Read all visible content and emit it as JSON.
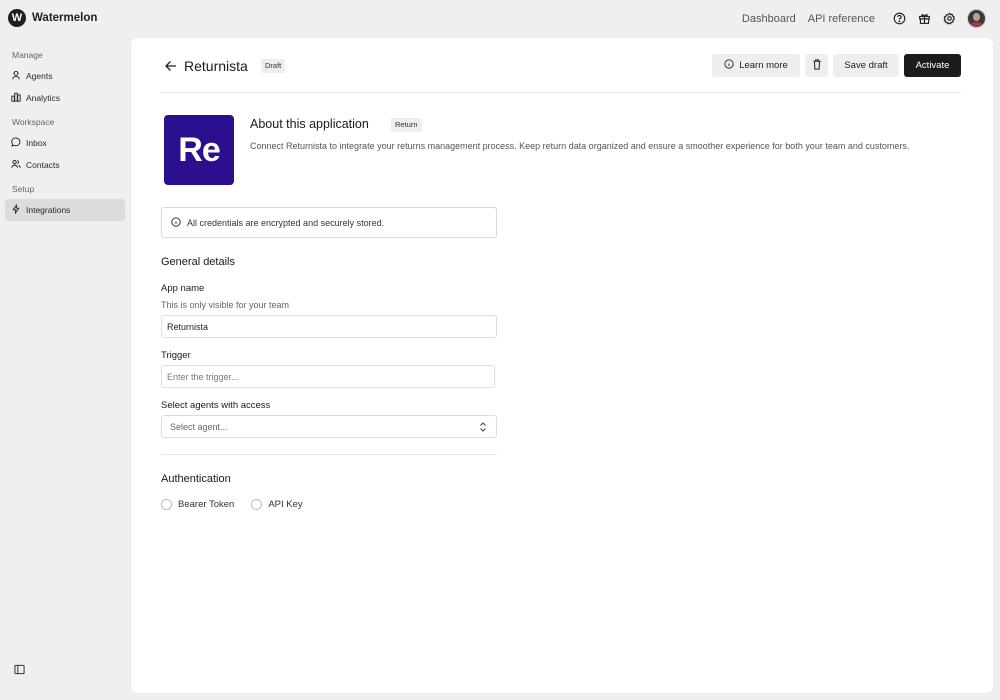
{
  "brand": {
    "logo_letter": "W",
    "name": "Watermelon"
  },
  "topnav": {
    "dashboard": "Dashboard",
    "api_reference": "API reference"
  },
  "sidebar": {
    "sections": [
      {
        "title": "Manage",
        "items": [
          {
            "label": "Agents",
            "icon": "agent-icon"
          },
          {
            "label": "Analytics",
            "icon": "bar-chart-icon"
          }
        ]
      },
      {
        "title": "Workspace",
        "items": [
          {
            "label": "Inbox",
            "icon": "chat-bubble-icon"
          },
          {
            "label": "Contacts",
            "icon": "users-icon"
          }
        ]
      },
      {
        "title": "Setup",
        "items": [
          {
            "label": "Integrations",
            "icon": "lightning-icon",
            "active": true
          }
        ]
      }
    ]
  },
  "header": {
    "title": "Returnista",
    "status_badge": "Draft",
    "learn_more": "Learn more",
    "save_draft": "Save draft",
    "activate": "Activate"
  },
  "about": {
    "icon_text": "Re",
    "icon_color": "#2b0f8e",
    "title": "About this application",
    "category_badge": "Return",
    "description": "Connect Returnista to integrate your returns management process. Keep return data organized and ensure a smoother experience for both your team and customers."
  },
  "notice": "All credentials are encrypted and securely stored.",
  "general": {
    "title": "General details",
    "app_name_label": "App name",
    "app_name_help": "This is only visible for your team",
    "app_name_value": "Returnista",
    "trigger_label": "Trigger",
    "trigger_placeholder": "Enter the trigger...",
    "agents_label": "Select agents with access",
    "agents_placeholder": "Select agent..."
  },
  "authentication": {
    "title": "Authentication",
    "options": [
      "Bearer Token",
      "API Key"
    ]
  }
}
